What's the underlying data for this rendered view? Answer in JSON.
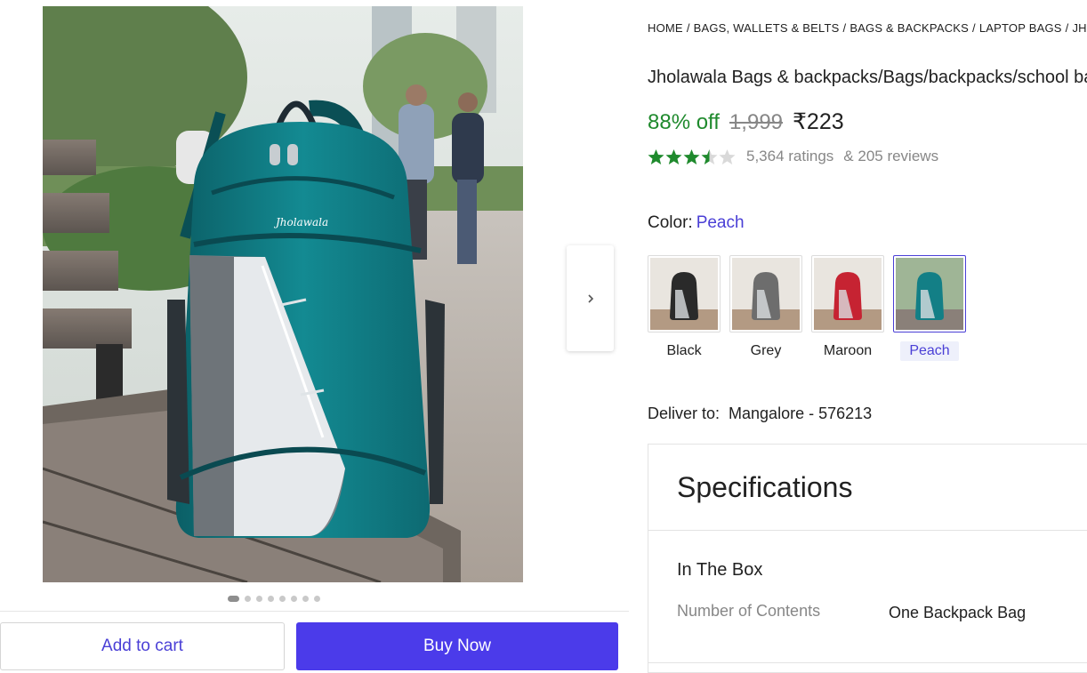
{
  "breadcrumb": [
    "Home",
    "Bags, Wallets & Belts",
    "Bags & Backpacks",
    "Laptop Bags",
    "Jholawala"
  ],
  "breadcrumb_separator": "/",
  "product": {
    "title": "Jholawala Bags & backpacks/Bags/backpacks/school bags",
    "discount": "88% off",
    "mrp": "1,999",
    "price": "₹223",
    "rating": 3.5,
    "ratings_count": "5,364 ratings",
    "reviews_count": "& 205 reviews",
    "brand_logo_text": "Jholawala"
  },
  "color": {
    "label": "Color:",
    "selected": "Peach",
    "options": [
      {
        "name": "Black",
        "swatch_hex": "#2a2a2a"
      },
      {
        "name": "Grey",
        "swatch_hex": "#6d6d6d"
      },
      {
        "name": "Maroon",
        "swatch_hex": "#c62332"
      },
      {
        "name": "Peach",
        "swatch_hex": "#137f86"
      }
    ]
  },
  "delivery": {
    "label": "Deliver to:",
    "location": "Mangalore - 576213"
  },
  "specifications": {
    "title": "Specifications",
    "section": "In The Box",
    "rows": [
      {
        "key": "Number of Contents",
        "value": "One Backpack Bag"
      }
    ]
  },
  "gallery": {
    "total_images": 8,
    "active_index": 0
  },
  "actions": {
    "add_to_cart": "Add to cart",
    "buy_now": "Buy Now"
  },
  "icons": {
    "next": "chevron-right-icon",
    "star": "star-icon"
  },
  "colors": {
    "accent": "#4b3bea",
    "discount_green": "#1f8a2d",
    "star_green": "#1f8a2d",
    "muted": "#878787"
  }
}
